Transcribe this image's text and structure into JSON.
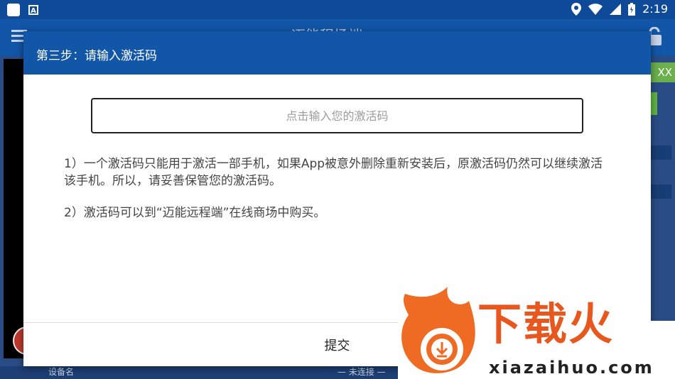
{
  "status_bar": {
    "time": "2:19",
    "badge_letter": "A"
  },
  "background": {
    "app_title": "迈能程场端",
    "green_label": "XX",
    "device_label": "设备名",
    "connection_status": "— 未连接 —"
  },
  "dialog": {
    "title": "第三步：请输入激活码",
    "input_placeholder": "点击输入您的激活码",
    "input_value": "",
    "note1": "1）一个激活码只能用于激活一部手机，如果App被意外删除重新安装后，原激活码仍然可以继续激活该手机。所以，请妥善保管您的激活码。",
    "note2": "2）激活码可以到“迈能远程端”在线商场中购买。",
    "submit_label": "提交"
  },
  "watermark": {
    "brand": "下载火",
    "url": "xiazaihuo.com"
  }
}
